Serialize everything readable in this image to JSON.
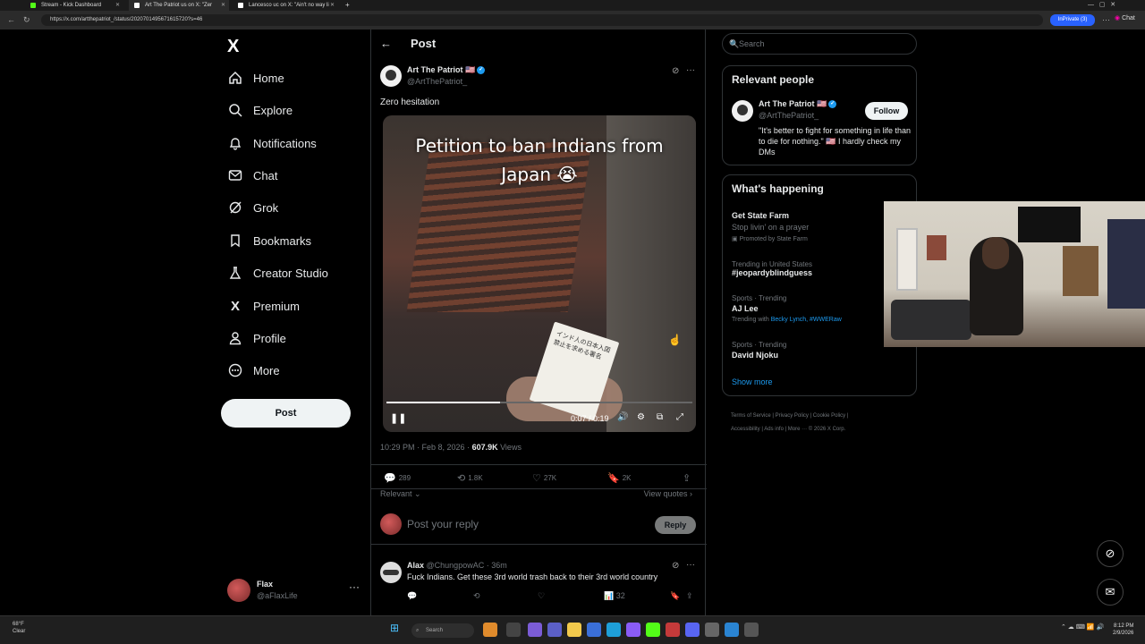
{
  "browser": {
    "tabs": [
      {
        "label": "Stream - Kick Dashboard",
        "color": "#53fc18"
      },
      {
        "label": "Art The Patriot us on X: \"Zer",
        "color": "#ffffff"
      },
      {
        "label": "Lancesco uc on X: \"Ain't no way li",
        "color": "#ffffff"
      }
    ],
    "url": "https://x.com/artthepatriot_/status/2020701495671615720?s=46",
    "inprivate_label": "InPrivate (3)",
    "chat_label": "Chat"
  },
  "sidebar": {
    "logo": "X",
    "items": [
      {
        "label": "Home",
        "icon": "home-icon"
      },
      {
        "label": "Explore",
        "icon": "search-icon"
      },
      {
        "label": "Notifications",
        "icon": "bell-icon"
      },
      {
        "label": "Chat",
        "icon": "mail-icon"
      },
      {
        "label": "Grok",
        "icon": "grok-icon"
      },
      {
        "label": "Bookmarks",
        "icon": "bookmark-icon"
      },
      {
        "label": "Creator Studio",
        "icon": "flask-icon"
      },
      {
        "label": "Premium",
        "icon": "x-icon"
      },
      {
        "label": "Profile",
        "icon": "person-icon"
      },
      {
        "label": "More",
        "icon": "more-circle-icon"
      }
    ],
    "post_label": "Post",
    "account": {
      "name": "Flax",
      "handle": "@aFlaxLife"
    }
  },
  "main": {
    "header_title": "Post",
    "tweet": {
      "author_name": "Art The Patriot 🇺🇸",
      "author_handle": "@ArtThePatriot_",
      "text": "Zero hesitation",
      "video_caption_1": "Petition to ban Indians from",
      "video_caption_2": "Japan 😭",
      "paper_text": "インド人の日本入国禁止を求める署名",
      "time_display": "0:07 / 0:19",
      "progress": 0.37,
      "timestamp": "10:29 PM · Feb 8, 2026 · ",
      "views_count": "607.9K",
      "views_label": " Views",
      "replies": "289",
      "reposts": "1.8K",
      "likes": "27K",
      "bookmarks": "2K"
    },
    "sort_label": "Relevant",
    "view_quotes": "View quotes",
    "reply_placeholder": "Post your reply",
    "reply_button": "Reply",
    "comment": {
      "author": "Alax",
      "handle_time": "@ChungpowAC · 36m",
      "text": "Fuck Indians. Get these 3rd world trash back to their 3rd world country",
      "views": "32"
    }
  },
  "right": {
    "search_placeholder": "Search",
    "relevant_people_title": "Relevant people",
    "person": {
      "name": "Art The Patriot 🇺🇸",
      "handle": "@ArtThePatriot_",
      "follow_label": "Follow",
      "bio": "\"It's better to fight for something in life than to die for nothing.\" 🇺🇸 I hardly check my DMs"
    },
    "happening_title": "What's happening",
    "trends": [
      {
        "title": "Get State Farm",
        "sub": "Stop livin' on a prayer",
        "extra": "Promoted by State Farm"
      },
      {
        "context": "Trending in United States",
        "title": "#jeopardyblindguess"
      },
      {
        "context": "Sports · Trending",
        "title": "AJ Lee",
        "with_prefix": "Trending with ",
        "with_links": "Becky Lynch, #WWERaw"
      },
      {
        "context": "Sports · Trending",
        "title": "David Njoku"
      }
    ],
    "show_more": "Show more",
    "footer_line1": "Terms of Service  |  Privacy Policy  |  Cookie Policy  |",
    "footer_line2": "Accessibility  |  Ads info  |  More ···  © 2026 X Corp."
  },
  "taskbar": {
    "weather_temp": "68°F",
    "weather_desc": "Clear",
    "search_label": "Search",
    "time": "8:12 PM",
    "date": "2/9/2026"
  }
}
